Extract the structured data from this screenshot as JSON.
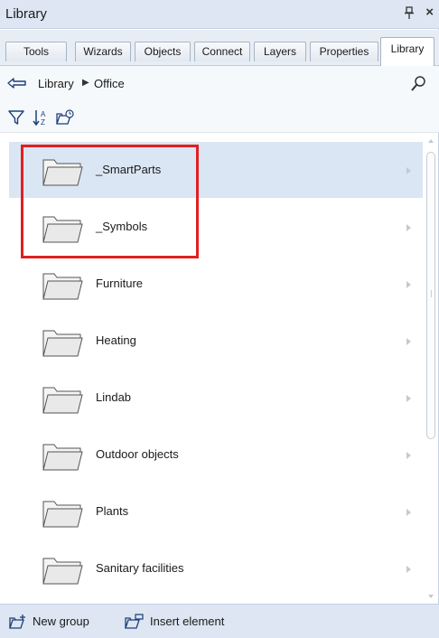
{
  "window": {
    "title": "Library"
  },
  "titlebar": {
    "pin_icon": "pin-icon",
    "close_glyph": "×"
  },
  "tabs": [
    {
      "label": "Tools"
    },
    {
      "label": "Wizards"
    },
    {
      "label": "Objects"
    },
    {
      "label": "Connect"
    },
    {
      "label": "Layers"
    },
    {
      "label": "Properties"
    },
    {
      "label": "Library",
      "active": true
    }
  ],
  "breadcrumb": {
    "items": [
      "Library",
      "Office"
    ],
    "separator": "▶"
  },
  "toolbar": {
    "icons": [
      "filter-icon",
      "sort-icon",
      "group-favorites-icon"
    ]
  },
  "list": {
    "items": [
      {
        "label": "_SmartParts",
        "selected": true
      },
      {
        "label": "_Symbols"
      },
      {
        "label": "Furniture"
      },
      {
        "label": "Heating"
      },
      {
        "label": "Lindab"
      },
      {
        "label": "Outdoor objects"
      },
      {
        "label": "Plants"
      },
      {
        "label": "Sanitary facilities"
      }
    ]
  },
  "footer": {
    "new_group_label": "New group",
    "insert_element_label": "Insert element"
  },
  "colors": {
    "highlight_border": "#e02020",
    "selected_row": "#dbe6f4",
    "panel_header": "#dde6f2"
  }
}
